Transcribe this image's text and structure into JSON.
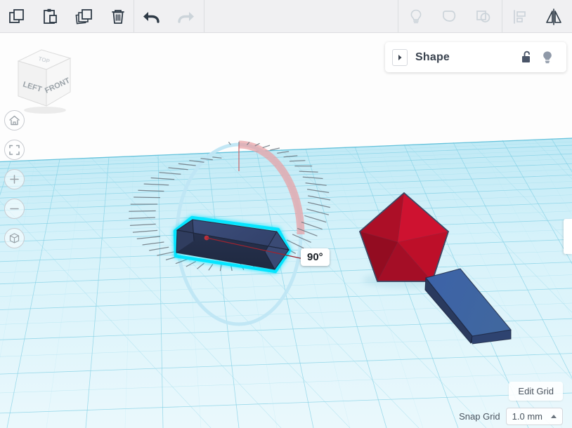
{
  "toolbar": {
    "groups": [
      {
        "name": "edit-group",
        "buttons": [
          {
            "icon": "copy-icon",
            "label": "Copy",
            "enabled": true
          },
          {
            "icon": "paste-icon",
            "label": "Paste",
            "enabled": true
          },
          {
            "icon": "duplicate-icon",
            "label": "Duplicate",
            "enabled": true
          },
          {
            "icon": "delete-icon",
            "label": "Delete",
            "enabled": true
          }
        ]
      },
      {
        "name": "history-group",
        "buttons": [
          {
            "icon": "undo-icon",
            "label": "Undo",
            "enabled": true
          },
          {
            "icon": "redo-icon",
            "label": "Redo",
            "enabled": false
          }
        ]
      },
      {
        "name": "object-group",
        "buttons": [
          {
            "icon": "lightbulb-icon",
            "label": "Show/Hide",
            "enabled": false
          },
          {
            "icon": "group-icon",
            "label": "Group",
            "enabled": false
          },
          {
            "icon": "ungroup-icon",
            "label": "Ungroup",
            "enabled": false
          }
        ]
      },
      {
        "name": "arrange-group",
        "buttons": [
          {
            "icon": "align-icon",
            "label": "Align",
            "enabled": false
          },
          {
            "icon": "mirror-icon",
            "label": "Mirror",
            "enabled": true
          }
        ]
      }
    ]
  },
  "shape_panel": {
    "title": "Shape",
    "collapse_icon": "chevron-right-icon",
    "lock_icon": "unlock-icon",
    "visibility_icon": "lightbulb-icon"
  },
  "viewcube": {
    "face_left": "LEFT",
    "face_front": "FRONT",
    "face_top": "TOP"
  },
  "nav_controls": [
    {
      "name": "home-view-button",
      "icon": "home-icon"
    },
    {
      "name": "fit-view-button",
      "icon": "fit-frame-icon"
    },
    {
      "name": "zoom-in-button",
      "icon": "plus-icon"
    },
    {
      "name": "zoom-out-button",
      "icon": "minus-icon"
    },
    {
      "name": "projection-toggle-button",
      "icon": "cube-perspective-icon"
    }
  ],
  "rotation": {
    "angle_label": "90°",
    "protractor_visible": true,
    "arc_color": "#e8a0a4",
    "pivot_color": "#c0392b"
  },
  "grid_controls": {
    "edit_grid_label": "Edit Grid",
    "snap_grid_label": "Snap Grid",
    "snap_grid_value": "1.0 mm",
    "snap_caret_icon": "caret-up-icon"
  },
  "scene": {
    "workplane_color": "#d3f0f8",
    "grid_line_color": "#7fcfe4",
    "objects": [
      {
        "name": "selected-box",
        "type": "box",
        "color": "#2c3e66",
        "selected": true,
        "highlight_color": "#00e5ff"
      },
      {
        "name": "red-polyhedron",
        "type": "polyhedron",
        "color": "#c8102e",
        "selected": false
      },
      {
        "name": "blue-wedge",
        "type": "wedge",
        "color": "#2e4a80",
        "selected": false
      }
    ]
  },
  "side_panel_handle": {
    "name": "side-drawer-handle"
  }
}
